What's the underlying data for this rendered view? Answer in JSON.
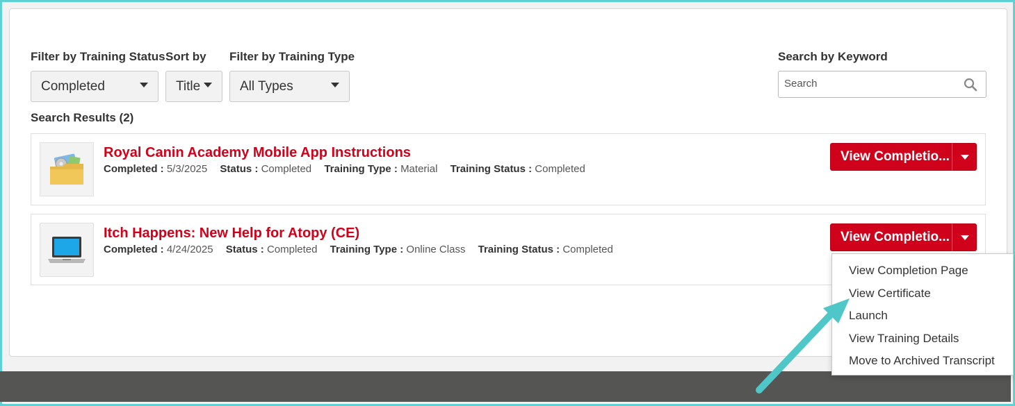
{
  "filters": {
    "training_status": {
      "label": "Filter by Training Status",
      "value": "Completed"
    },
    "sort": {
      "label": "Sort by",
      "value": "Title"
    },
    "training_type": {
      "label": "Filter by Training Type",
      "value": "All Types"
    },
    "keyword": {
      "label": "Search by Keyword",
      "placeholder": "Search"
    }
  },
  "results": {
    "title": "Search Results (2)",
    "items": [
      {
        "title": "Royal Canin Academy Mobile App Instructions",
        "completed_label": "Completed :",
        "completed": "5/3/2025",
        "status_label": "Status :",
        "status": "Completed",
        "type_label": "Training Type :",
        "type": "Material",
        "tstatus_label": "Training Status :",
        "tstatus": "Completed",
        "button": "View Completio...",
        "icon": "folder-icon"
      },
      {
        "title": "Itch Happens: New Help for Atopy (CE)",
        "completed_label": "Completed :",
        "completed": "4/24/2025",
        "status_label": "Status :",
        "status": "Completed",
        "type_label": "Training Type :",
        "type": "Online Class",
        "tstatus_label": "Training Status :",
        "tstatus": "Completed",
        "button": "View Completio...",
        "icon": "laptop-icon"
      }
    ]
  },
  "menu": {
    "items": [
      "View Completion Page",
      "View Certificate",
      "Launch",
      "View Training Details",
      "Move to Archived Transcript"
    ]
  },
  "colors": {
    "accent": "#d0021b",
    "frame": "#5fd0d3",
    "annotation_arrow": "#4fc6c8",
    "footer": "#555553"
  }
}
